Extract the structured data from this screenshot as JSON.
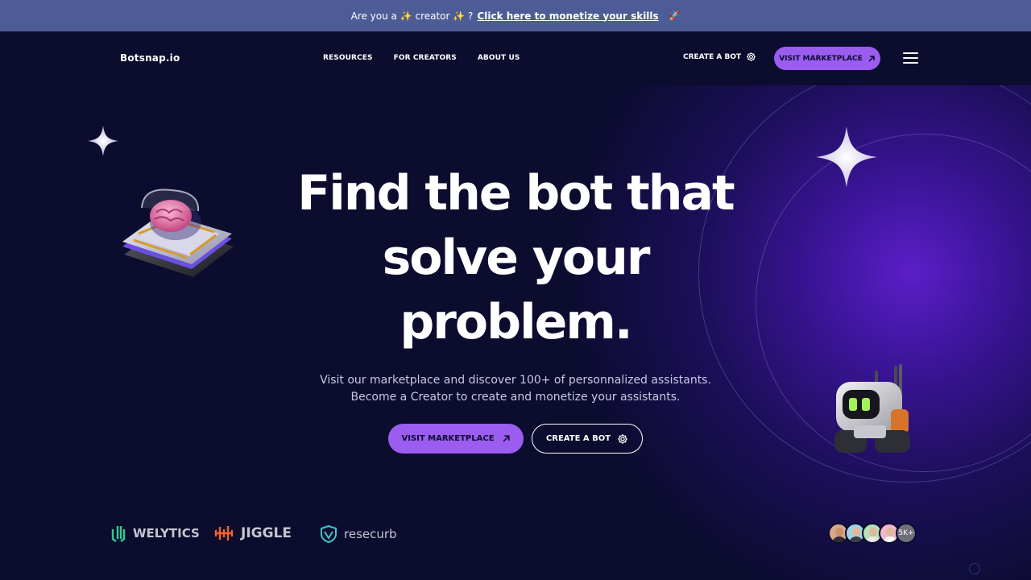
{
  "announcement": {
    "prefix": "Are you a ✨ creator ✨ ?",
    "link": "Click here to monetize your skills",
    "suffix_icon": "rocket-icon"
  },
  "header": {
    "logo": "Botsnap.io",
    "nav": [
      "RESOURCES",
      "FOR CREATORS",
      "ABOUT US"
    ],
    "create_link": "CREATE A BOT",
    "marketplace_button": "VISIT MARKETPLACE",
    "menu_icon": "hamburger-menu-icon"
  },
  "hero": {
    "headline_line1": "Find the bot that",
    "headline_line2": "solve your",
    "headline_line3": "problem.",
    "sub_line1": "Visit our marketplace and discover 100+ of personnalized assistants.",
    "sub_line2": "Become a Creator to create and monetize your assistants.",
    "primary_button": "VISIT MARKETPLACE",
    "secondary_button": "CREATE A BOT"
  },
  "partners": [
    "WELYTICS",
    "JIGGLE",
    "resecurb"
  ],
  "community": {
    "count": "5K+"
  },
  "colors": {
    "background": "#0b0c2e",
    "announcement_bar": "#4d5c96",
    "accent": "#9b5cf0",
    "glow": "#5b1ec8"
  }
}
